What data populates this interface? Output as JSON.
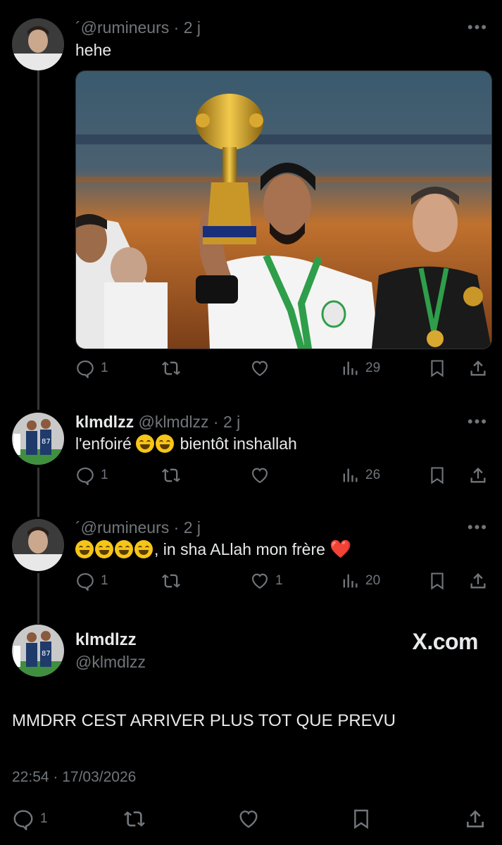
{
  "posts": [
    {
      "display_name": "",
      "handle": "´@rumineurs",
      "time": "· 2 j",
      "text": "hehe",
      "actions": {
        "replies": "1",
        "reposts": "",
        "likes": "",
        "views": "29"
      }
    },
    {
      "display_name": "klmdlzz",
      "handle": "@klmdlzz",
      "time": "· 2 j",
      "text_before": "l'enfoiré",
      "text_after": "bientôt inshallah",
      "emojis": [
        "face-with-tears-of-joy",
        "face-with-tears-of-joy"
      ],
      "actions": {
        "replies": "1",
        "reposts": "",
        "likes": "",
        "views": "26"
      }
    },
    {
      "display_name": "",
      "handle": "´@rumineurs",
      "time": "· 2 j",
      "emojis": [
        "rolling-on-floor-laughing",
        "rolling-on-floor-laughing",
        "rolling-on-floor-laughing",
        "rolling-on-floor-laughing"
      ],
      "text_after": ", in sha ALlah mon frère",
      "heart": "❤️",
      "actions": {
        "replies": "1",
        "reposts": "",
        "likes": "1",
        "views": "20"
      }
    }
  ],
  "main_post": {
    "display_name": "klmdlzz",
    "handle": "@klmdlzz",
    "watermark": "X.com",
    "text": "MMDRR CEST ARRIVER PLUS TOT QUE PREVU",
    "timestamp": "22:54 · 17/03/2026",
    "actions": {
      "replies": "1"
    }
  },
  "more_label": "•••",
  "colors": {
    "background": "#000000",
    "text": "#e7e9ea",
    "muted": "#71767b",
    "line": "#333639"
  }
}
